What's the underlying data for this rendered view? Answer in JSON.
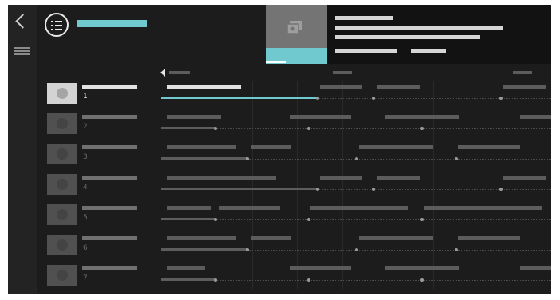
{
  "channels": [
    {
      "number": "1",
      "state": "selected",
      "progress": 0.4
    },
    {
      "number": "2",
      "state": "normal",
      "progress": 0.14
    },
    {
      "number": "3",
      "state": "normal",
      "progress": 0.22
    },
    {
      "number": "4",
      "state": "normal",
      "progress": 0.4
    },
    {
      "number": "5",
      "state": "normal",
      "progress": 0.14
    },
    {
      "number": "6",
      "state": "normal",
      "progress": 0.22
    },
    {
      "number": "7",
      "state": "normal",
      "progress": 0.14
    }
  ],
  "colors": {
    "accent": "#6fc9cf",
    "add_button": "#f5a623",
    "background": "#1c1c1c"
  },
  "icons": {
    "back": "chevron-left-icon",
    "menu": "hamburger-menu-icon",
    "guide": "tv-guide-icon",
    "program": "tv-program-icon",
    "add": "plus-circle-icon",
    "time_marker": "triangle-left-icon"
  },
  "add_button_label": "+"
}
